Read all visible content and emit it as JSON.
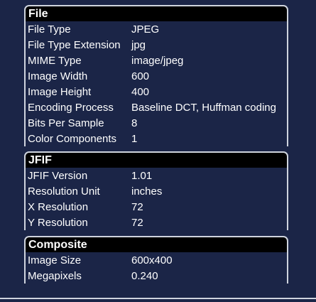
{
  "sections": [
    {
      "title": "File",
      "rows": [
        {
          "key": "File Type",
          "value": "JPEG"
        },
        {
          "key": "File Type Extension",
          "value": "jpg"
        },
        {
          "key": "MIME Type",
          "value": "image/jpeg"
        },
        {
          "key": "Image Width",
          "value": "600"
        },
        {
          "key": "Image Height",
          "value": "400"
        },
        {
          "key": "Encoding Process",
          "value": "Baseline DCT, Huffman coding"
        },
        {
          "key": "Bits Per Sample",
          "value": "8"
        },
        {
          "key": "Color Components",
          "value": "1"
        }
      ]
    },
    {
      "title": "JFIF",
      "rows": [
        {
          "key": "JFIF Version",
          "value": "1.01"
        },
        {
          "key": "Resolution Unit",
          "value": "inches"
        },
        {
          "key": "X Resolution",
          "value": "72"
        },
        {
          "key": "Y Resolution",
          "value": "72"
        }
      ]
    },
    {
      "title": "Composite",
      "rows": [
        {
          "key": "Image Size",
          "value": "600x400"
        },
        {
          "key": "Megapixels",
          "value": "0.240"
        }
      ]
    }
  ]
}
